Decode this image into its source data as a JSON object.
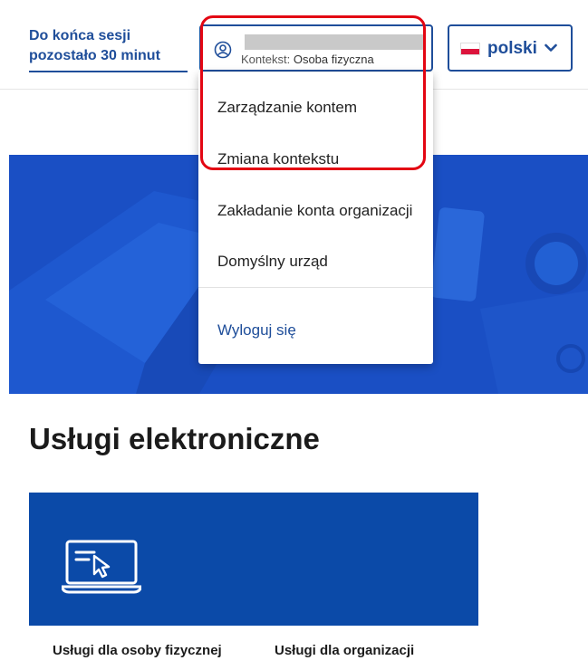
{
  "header": {
    "session_line1": "Do końca sesji",
    "session_line2": "pozostało 30 minut",
    "account": {
      "context_label": "Kontekst:",
      "context_value": "Osoba fizyczna",
      "icon": "user-circle-icon"
    },
    "language": {
      "label": "polski",
      "flag": "poland-flag",
      "chevron": "chevron-down-icon"
    }
  },
  "account_menu": {
    "items": [
      {
        "label": "Zarządzanie kontem"
      },
      {
        "label": "Zmiana kontekstu"
      },
      {
        "label": "Zakładanie konta organizacji"
      },
      {
        "label": "Domyślny urząd"
      }
    ],
    "logout_label": "Wyloguj się"
  },
  "services": {
    "title": "Usługi elektroniczne",
    "tile_icon": "laptop-cursor-icon",
    "categories": [
      {
        "label": "Usługi dla osoby fizycznej"
      },
      {
        "label": "Usługi dla organizacji"
      }
    ]
  },
  "colors": {
    "primary": "#1f4e9a",
    "hero_blue": "#1a4fc4",
    "tile_blue": "#0b4aa8",
    "highlight": "#e30613"
  }
}
